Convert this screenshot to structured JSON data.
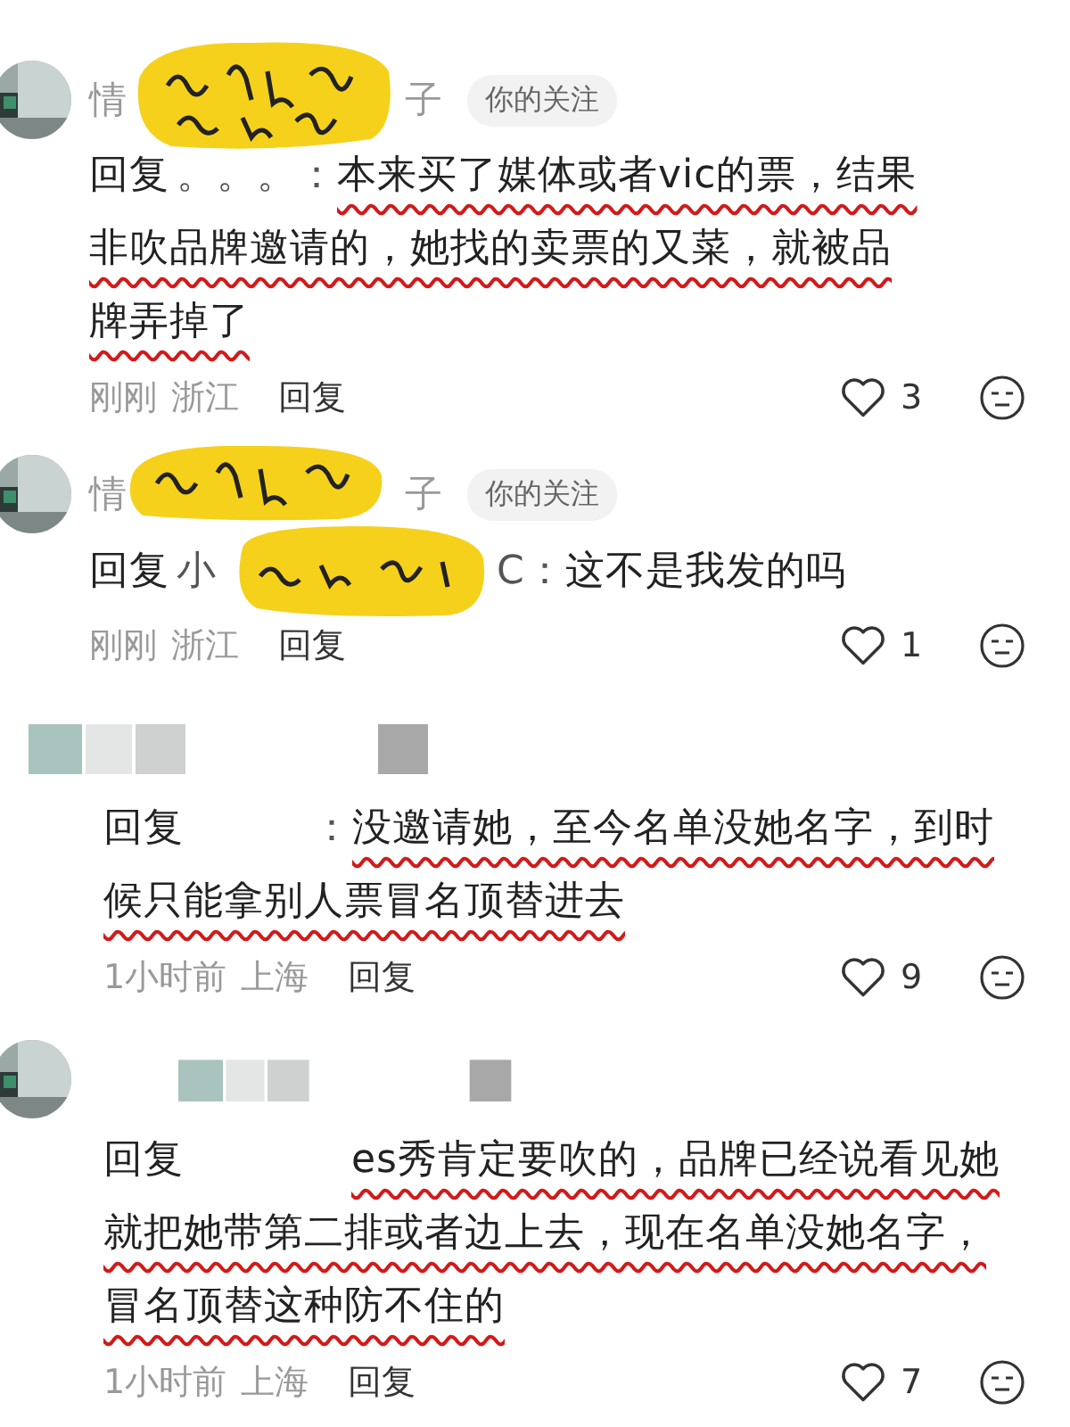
{
  "comments": [
    {
      "avatar": true,
      "name_parts": [
        "情",
        "子"
      ],
      "sticker": true,
      "follow_tag": "你的关注",
      "blurred_name": false,
      "reply_label": "回复",
      "target_parts": [
        "。。。："
      ],
      "segments": [
        {
          "text": "本来买了媒体或者vic的票，结果非吹品牌邀请的，她找的卖票的又菜，就被品牌弄掉了",
          "underlined": true
        }
      ],
      "time": "刚刚",
      "location": "浙江",
      "reply_button": "回复",
      "likes": "3"
    },
    {
      "avatar": true,
      "name_parts": [
        "情",
        "子"
      ],
      "sticker": true,
      "follow_tag": "你的关注",
      "blurred_name": false,
      "reply_label": "回复",
      "target_parts": [
        "小",
        "C："
      ],
      "segments": [
        {
          "text": "这不是我发的吗",
          "underlined": false
        }
      ],
      "time": "刚刚",
      "location": "浙江",
      "reply_button": "回复",
      "likes": "1"
    },
    {
      "avatar": false,
      "sticker": false,
      "blurred_name": true,
      "reply_label": "回复",
      "blurred_target": true,
      "target_parts": [
        "："
      ],
      "segments": [
        {
          "text": "没邀请她，至今名单没她名字，到时候只能拿别人票冒名顶替进去",
          "underlined": true
        }
      ],
      "time": "1小时前",
      "location": "上海",
      "reply_button": "回复",
      "likes": "9"
    },
    {
      "avatar": true,
      "sticker": false,
      "blurred_name": true,
      "reply_label": "回复",
      "blurred_target": true,
      "segments": [
        {
          "text": "es秀肯定要吹的，品牌已经说看见她就把她带第二排或者边上去，现在名单没她名字，冒名顶替这种防不住的",
          "underlined": true
        }
      ],
      "time": "1小时前",
      "location": "上海",
      "reply_button": "回复",
      "likes": "7"
    }
  ]
}
